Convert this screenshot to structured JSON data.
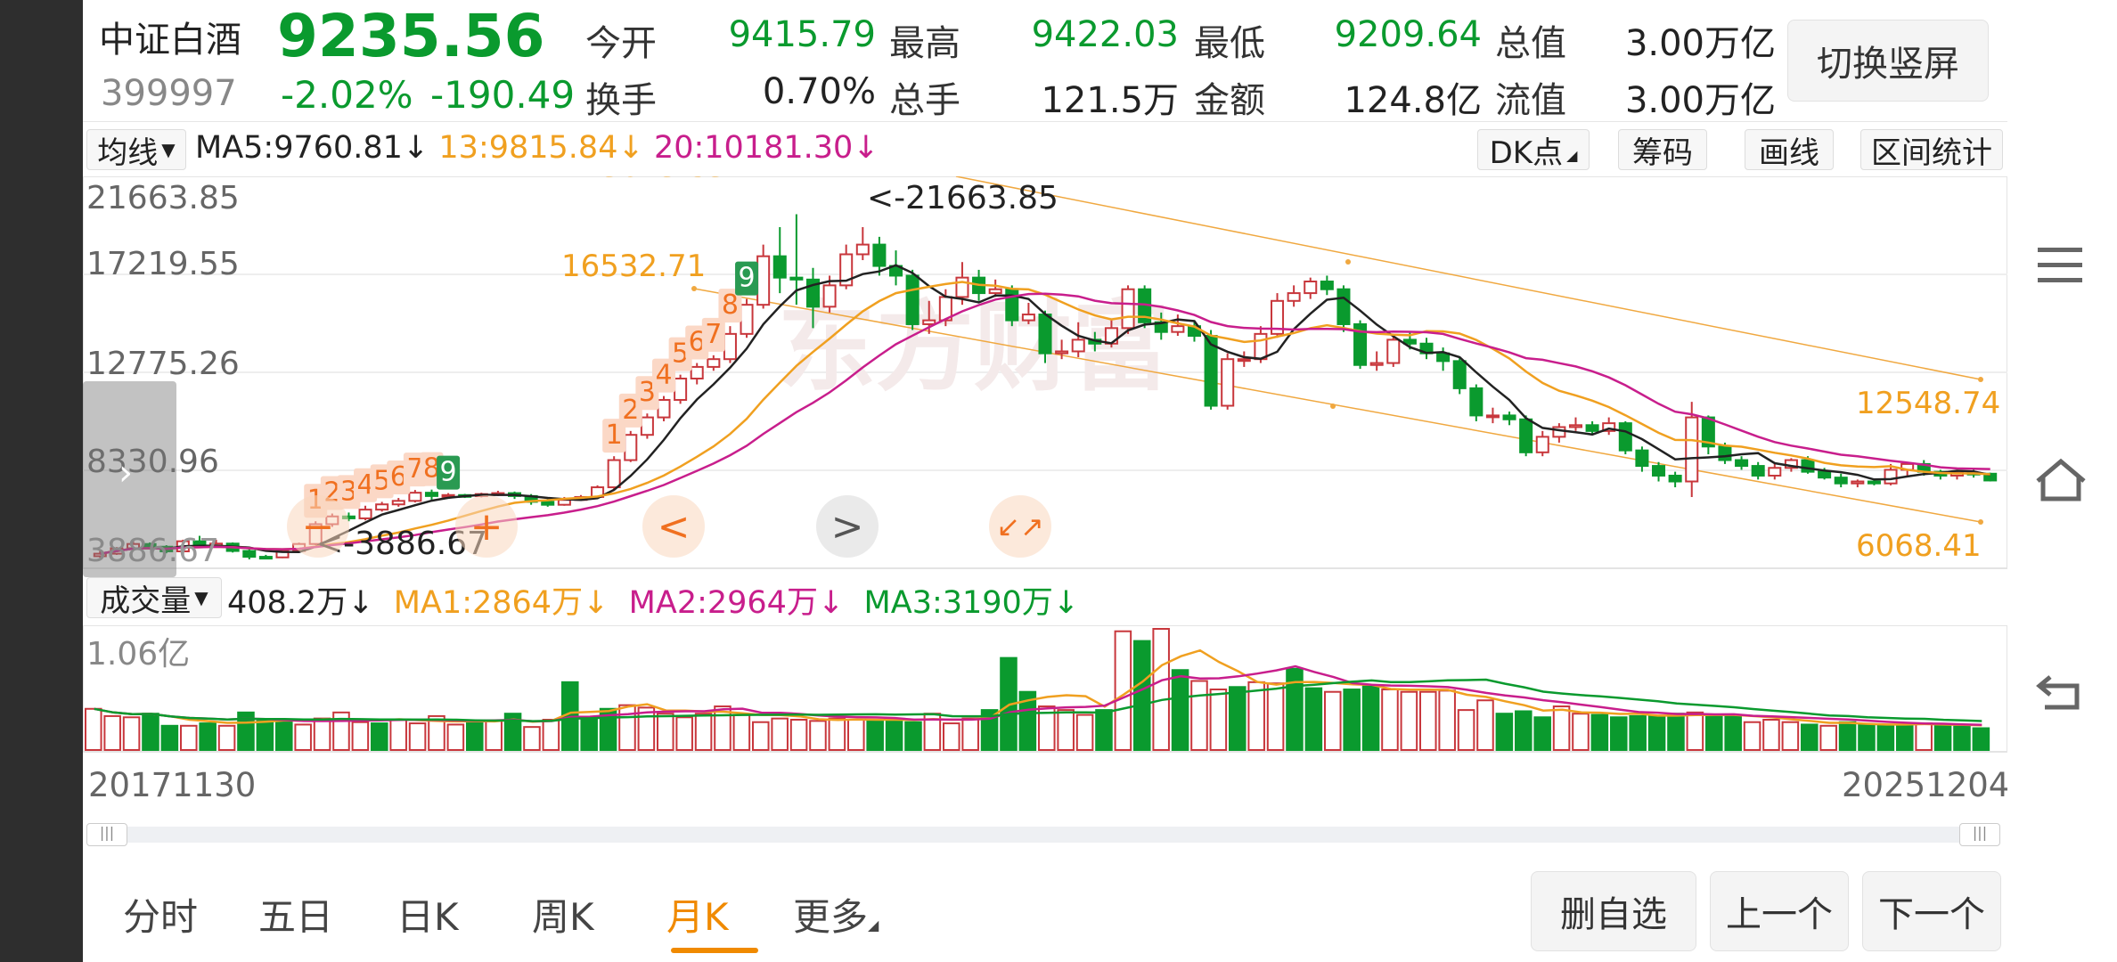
{
  "quote": {
    "name": "中证白酒",
    "code": "399997",
    "price": "9235.56",
    "change_pct": "-2.02%",
    "change": "-190.49",
    "fields": [
      {
        "label": "今开",
        "value": "9415.79",
        "color": "#0a9a2e"
      },
      {
        "label": "最高",
        "value": "9422.03",
        "color": "#0a9a2e"
      },
      {
        "label": "最低",
        "value": "9209.64",
        "color": "#0a9a2e"
      },
      {
        "label": "总值",
        "value": "3.00万亿",
        "color": "#222222"
      },
      {
        "label": "换手",
        "value": "0.70%",
        "color": "#222222"
      },
      {
        "label": "总手",
        "value": "121.5万",
        "color": "#222222"
      },
      {
        "label": "金额",
        "value": "124.8亿",
        "color": "#222222"
      },
      {
        "label": "流值",
        "value": "3.00万亿",
        "color": "#222222"
      }
    ],
    "switch_button": "切换竖屏"
  },
  "indicator_bar": {
    "selector": "均线",
    "ma5": "MA5:9760.81",
    "ma13": "13:9815.84",
    "ma20": "20:10181.30",
    "arrow": "↓",
    "tools": [
      "DK点",
      "筹码",
      "画线",
      "区间统计"
    ]
  },
  "main_chart": {
    "y_labels": [
      "21663.85",
      "17219.55",
      "12775.26",
      "8330.96",
      "3886.67"
    ],
    "cropped_top_label": "23613.83",
    "high_marker": "<-21663.85",
    "low_marker": "<-3886.67",
    "channel_labels": {
      "upper_left": "16532.71",
      "right_upper": "12548.74",
      "right_lower": "6068.41"
    },
    "watermark": "东方财富",
    "td_sequence_1": [
      "1",
      "2",
      "3",
      "4",
      "5",
      "6",
      "7",
      "8",
      "9"
    ],
    "td_sequence_2": [
      "1",
      "2",
      "3",
      "4",
      "5",
      "6",
      "7",
      "8",
      "9"
    ],
    "controls": {
      "prev": "<",
      "next": ">",
      "add": "+",
      "shrink": "↙↗"
    }
  },
  "volume_bar": {
    "selector": "成交量",
    "current": "408.2万",
    "ma1": "MA1:2864万",
    "ma2": "MA2:2964万",
    "ma3": "MA3:3190万",
    "arrow": "↓",
    "y_label": "1.06亿",
    "start_date": "20171130",
    "end_date": "20251204"
  },
  "tabs": [
    "分时",
    "五日",
    "日K",
    "周K",
    "月K",
    "更多"
  ],
  "active_tab": "月K",
  "bottom_buttons": [
    "删自选",
    "上一个",
    "下一个"
  ],
  "right_icons": [
    "menu-icon",
    "home-icon",
    "back-icon"
  ],
  "colors": {
    "up": "#c8373c",
    "down": "#0a9a2e",
    "ma5": "#222222",
    "ma13": "#f0a020",
    "ma20": "#c81e8c",
    "accent": "#f08a00",
    "volume_ma3": "#0a9a2e"
  },
  "chart_data": {
    "type": "candlestick",
    "title": "",
    "y_axis_ticks": [
      21663.85,
      17219.55,
      12775.26,
      8330.96,
      3886.67
    ],
    "ylim": [
      3886.67,
      23613.83
    ],
    "x_range": [
      "20171130",
      "20251204"
    ],
    "candles": [
      [
        4050,
        4180,
        4320,
        3980
      ],
      [
        4180,
        4460,
        4520,
        4120
      ],
      [
        4460,
        4680,
        4840,
        4380
      ],
      [
        4680,
        4540,
        4760,
        4400
      ],
      [
        4540,
        4300,
        4620,
        4200
      ],
      [
        4300,
        4820,
        4900,
        4260
      ],
      [
        4820,
        4600,
        5100,
        4520
      ],
      [
        4600,
        4700,
        4900,
        4480
      ],
      [
        4700,
        4320,
        4760,
        4240
      ],
      [
        4320,
        4020,
        4420,
        3886.67
      ],
      [
        4020,
        3990,
        4120,
        3900
      ],
      [
        3990,
        4320,
        4400,
        3950
      ],
      [
        4320,
        4680,
        4750,
        4250
      ],
      [
        4680,
        5700,
        5850,
        4620
      ],
      [
        5700,
        6100,
        6250,
        5560
      ],
      [
        6100,
        6000,
        6300,
        5850
      ],
      [
        6000,
        6450,
        6650,
        5900
      ],
      [
        6450,
        6720,
        6850,
        6350
      ],
      [
        6720,
        6900,
        7050,
        6600
      ],
      [
        6900,
        7320,
        7460,
        6820
      ],
      [
        7320,
        7150,
        7480,
        6950
      ],
      [
        7150,
        7200,
        7300,
        7020
      ],
      [
        7200,
        7150,
        7260,
        7050
      ],
      [
        7150,
        7250,
        7320,
        7080
      ],
      [
        7250,
        7300,
        7420,
        7150
      ],
      [
        7300,
        7150,
        7380,
        7000
      ],
      [
        7150,
        6850,
        7250,
        6700
      ],
      [
        6850,
        6700,
        7000,
        6600
      ],
      [
        6700,
        6950,
        7100,
        6650
      ],
      [
        6950,
        7100,
        7200,
        6900
      ],
      [
        7100,
        7600,
        7700,
        7000
      ],
      [
        7600,
        9000,
        9200,
        7500
      ],
      [
        9000,
        10300,
        10500,
        8900
      ],
      [
        10300,
        11200,
        11400,
        10100
      ],
      [
        11200,
        12100,
        12300,
        11000
      ],
      [
        12100,
        13200,
        13400,
        11900
      ],
      [
        13200,
        13800,
        14000,
        12900
      ],
      [
        13800,
        14200,
        14400,
        13600
      ],
      [
        14200,
        15500,
        15900,
        14000
      ],
      [
        15500,
        17000,
        17300,
        15300
      ],
      [
        17000,
        19500,
        20100,
        16800
      ],
      [
        19500,
        18400,
        21000,
        17600
      ],
      [
        18400,
        18300,
        21663.85,
        17000
      ],
      [
        18300,
        16900,
        18900,
        15800
      ],
      [
        16900,
        18000,
        18500,
        16600
      ],
      [
        18000,
        19600,
        20100,
        17800
      ],
      [
        19600,
        20100,
        21000,
        19300
      ],
      [
        20100,
        19000,
        20500,
        18500
      ],
      [
        19000,
        18500,
        19800,
        18000
      ],
      [
        18500,
        16000,
        18800,
        15700
      ],
      [
        16000,
        16200,
        17200,
        15500
      ],
      [
        16200,
        17400,
        17800,
        15900
      ],
      [
        17400,
        18400,
        19200,
        17000
      ],
      [
        18400,
        17600,
        18800,
        17200
      ],
      [
        17600,
        17800,
        18300,
        17400
      ],
      [
        17800,
        16200,
        18000,
        15900
      ],
      [
        16200,
        16500,
        17100,
        16000
      ],
      [
        16500,
        14500,
        16700,
        14000
      ],
      [
        14500,
        14600,
        15200,
        14200
      ],
      [
        14600,
        15200,
        16100,
        14300
      ],
      [
        15200,
        15000,
        15600,
        14600
      ],
      [
        15000,
        15800,
        16200,
        14800
      ],
      [
        15800,
        17800,
        18000,
        15500
      ],
      [
        17800,
        16100,
        18000,
        15800
      ],
      [
        16100,
        15600,
        16600,
        15200
      ],
      [
        15600,
        15900,
        16500,
        15400
      ],
      [
        15900,
        15400,
        16200,
        15100
      ],
      [
        15400,
        11800,
        15700,
        11600
      ],
      [
        11800,
        14200,
        14500,
        11600
      ],
      [
        14200,
        14200,
        14600,
        13800
      ],
      [
        14200,
        15500,
        15900,
        14000
      ],
      [
        15500,
        17200,
        17600,
        15300
      ],
      [
        17200,
        17600,
        18000,
        16900
      ],
      [
        17600,
        18200,
        18400,
        17300
      ],
      [
        18200,
        17800,
        18500,
        17500
      ],
      [
        17800,
        16000,
        18000,
        15600
      ],
      [
        16000,
        13900,
        16200,
        13700
      ],
      [
        13900,
        14000,
        14600,
        13600
      ],
      [
        14000,
        15200,
        15500,
        13800
      ],
      [
        15200,
        15000,
        15600,
        14700
      ],
      [
        15000,
        14500,
        15300,
        14200
      ],
      [
        14500,
        14100,
        14800,
        13600
      ],
      [
        14100,
        12700,
        14300,
        12400
      ],
      [
        12700,
        11300,
        12900,
        11000
      ],
      [
        11300,
        11300,
        11700,
        10900
      ],
      [
        11300,
        11100,
        11500,
        10800
      ],
      [
        11100,
        9400,
        11300,
        9200
      ],
      [
        9400,
        10200,
        10500,
        9200
      ],
      [
        10200,
        10700,
        10900,
        9900
      ],
      [
        10700,
        10800,
        11200,
        10500
      ],
      [
        10800,
        10500,
        11000,
        10300
      ],
      [
        10500,
        10900,
        11200,
        10300
      ],
      [
        10900,
        9500,
        11000,
        9300
      ],
      [
        9500,
        8700,
        9700,
        8400
      ],
      [
        8700,
        8200,
        8900,
        7900
      ],
      [
        8200,
        7900,
        8400,
        7600
      ],
      [
        7900,
        11200,
        12000,
        7100
      ],
      [
        11200,
        9700,
        11300,
        9300
      ],
      [
        9700,
        9000,
        9900,
        8800
      ],
      [
        9000,
        8700,
        9200,
        8500
      ],
      [
        8700,
        8200,
        8900,
        8000
      ],
      [
        8200,
        8600,
        8800,
        8000
      ],
      [
        8600,
        9000,
        9100,
        8400
      ],
      [
        9000,
        8400,
        9200,
        8300
      ],
      [
        8400,
        8100,
        8600,
        8000
      ],
      [
        8100,
        7800,
        8300,
        7600
      ],
      [
        7800,
        7900,
        8000,
        7600
      ],
      [
        7900,
        7800,
        8000,
        7700
      ],
      [
        7800,
        8500,
        8800,
        7700
      ],
      [
        8500,
        8800,
        8900,
        8200
      ],
      [
        8800,
        8400,
        9000,
        8200
      ],
      [
        8400,
        8200,
        8500,
        8000
      ],
      [
        8200,
        8350,
        8500,
        8000
      ],
      [
        8350,
        8300,
        8600,
        8100
      ],
      [
        8300,
        7950,
        8350,
        7900
      ]
    ],
    "volumes": [
      0.34,
      0.28,
      0.27,
      0.3,
      0.2,
      0.2,
      0.22,
      0.2,
      0.31,
      0.24,
      0.25,
      0.21,
      0.26,
      0.31,
      0.23,
      0.22,
      0.25,
      0.22,
      0.28,
      0.21,
      0.23,
      0.24,
      0.3,
      0.19,
      0.25,
      0.56,
      0.27,
      0.34,
      0.37,
      0.35,
      0.3,
      0.27,
      0.3,
      0.36,
      0.29,
      0.23,
      0.26,
      0.25,
      0.24,
      0.26,
      0.25,
      0.25,
      0.25,
      0.23,
      0.3,
      0.22,
      0.26,
      0.33,
      0.76,
      0.48,
      0.36,
      0.33,
      0.29,
      0.33,
      0.98,
      0.9,
      1.0,
      0.66,
      0.57,
      0.5,
      0.52,
      0.56,
      0.55,
      0.67,
      0.51,
      0.48,
      0.5,
      0.53,
      0.5,
      0.48,
      0.48,
      0.49,
      0.33,
      0.41,
      0.3,
      0.32,
      0.27,
      0.36,
      0.3,
      0.29,
      0.27,
      0.28,
      0.28,
      0.3,
      0.31,
      0.28,
      0.28,
      0.23,
      0.25,
      0.23,
      0.21,
      0.2,
      0.23,
      0.21,
      0.2,
      0.21,
      0.22,
      0.21,
      0.2,
      0.18
    ],
    "ma_last": {
      "MA5": 9760.81,
      "MA13": 9815.84,
      "MA20": 10181.3
    }
  }
}
